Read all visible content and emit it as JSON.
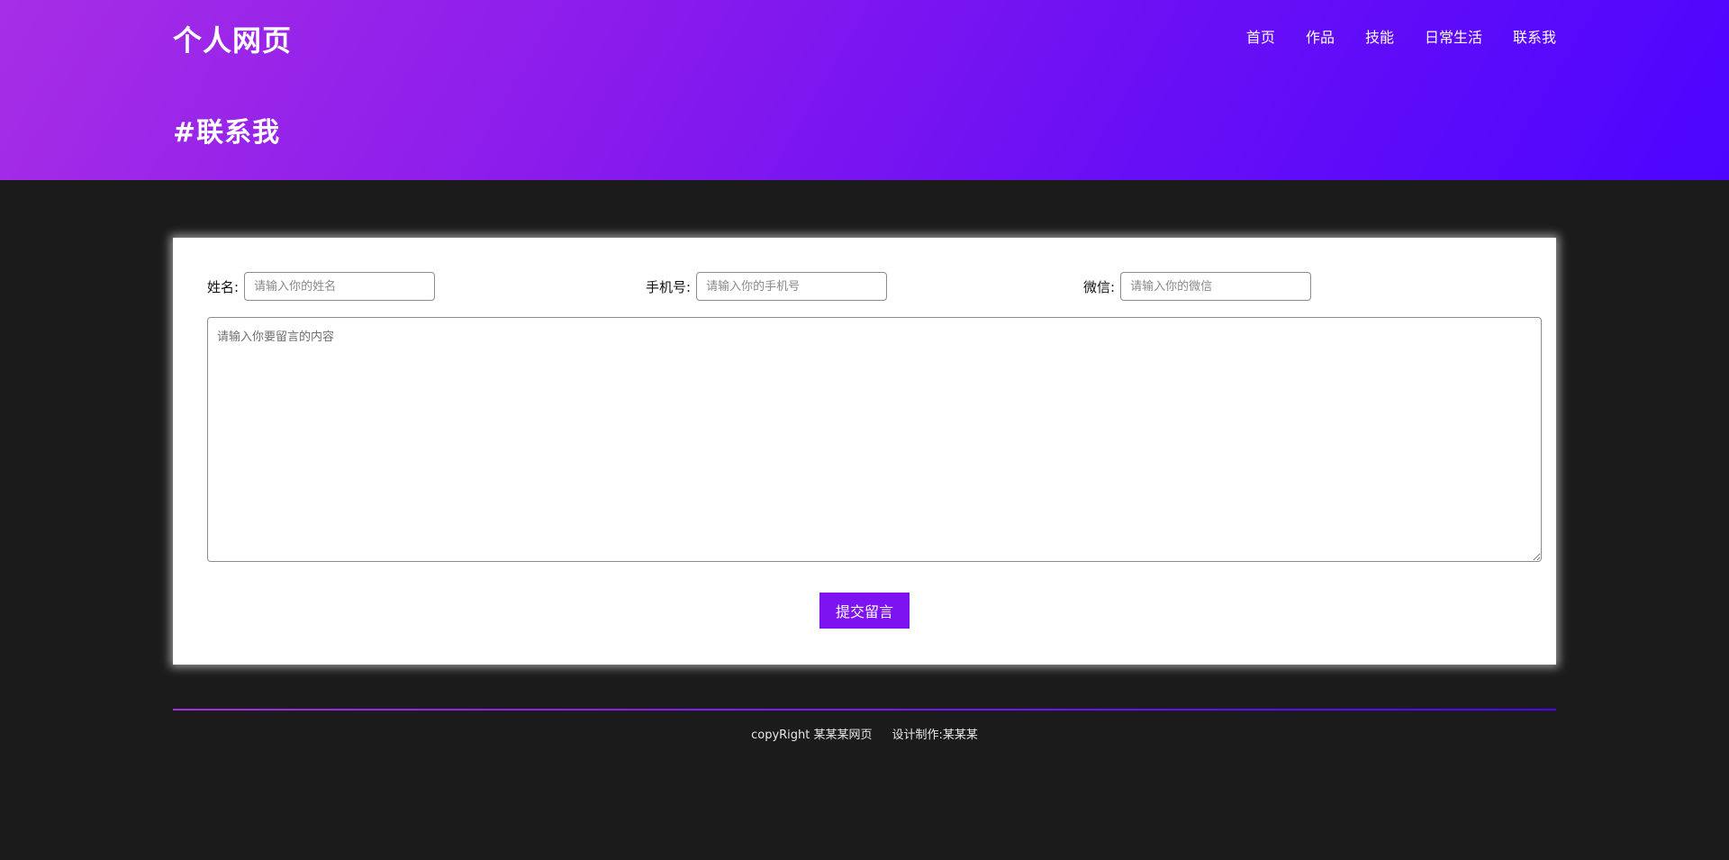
{
  "header": {
    "logo": "个人网页",
    "nav": [
      "首页",
      "作品",
      "技能",
      "日常生活",
      "联系我"
    ],
    "page_heading": "#联系我"
  },
  "form": {
    "name_label": "姓名:",
    "name_placeholder": "请输入你的姓名",
    "phone_label": "手机号:",
    "phone_placeholder": "请输入你的手机号",
    "wechat_label": "微信:",
    "wechat_placeholder": "请输入你的微信",
    "message_placeholder": "请输入你要留言的内容",
    "submit_label": "提交留言"
  },
  "footer": {
    "copyright": "copyRight 某某某网页",
    "design": "设计制作:某某某"
  },
  "colors": {
    "header_gradient_start": "#a72ee6",
    "header_gradient_end": "#4c05ff",
    "accent": "#7d13f0",
    "page_background": "#1b1b1b"
  }
}
